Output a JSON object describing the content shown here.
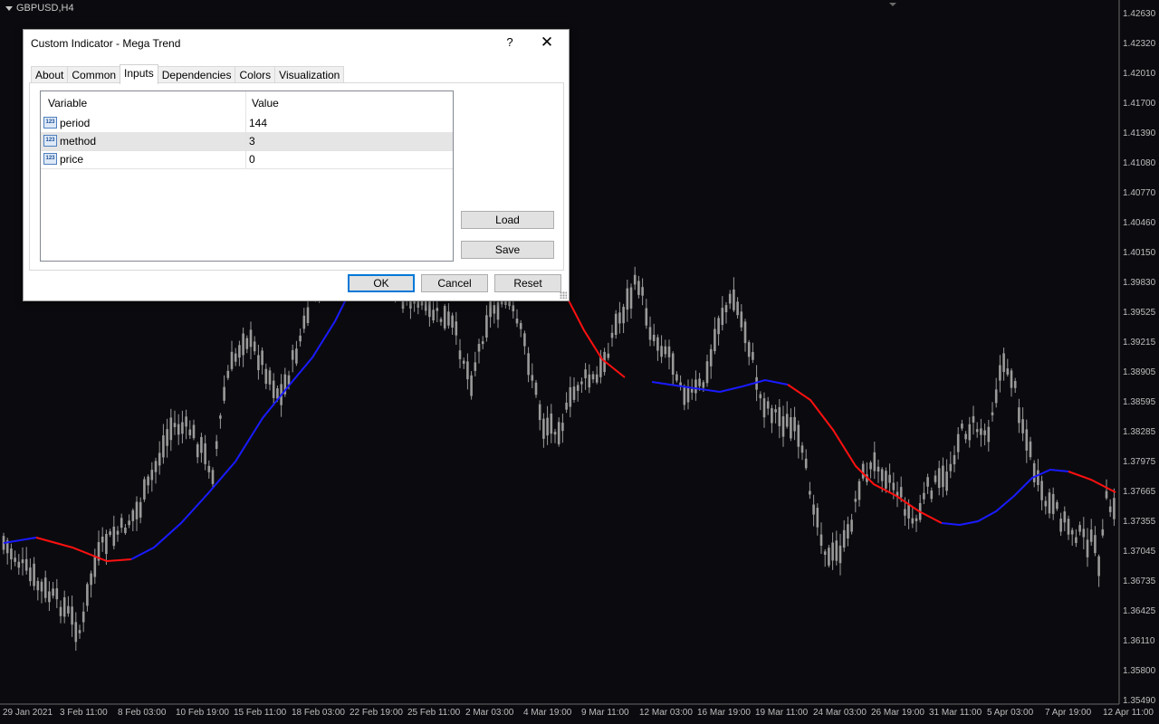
{
  "chart": {
    "symbol": "GBPUSD,H4",
    "price_ticks": [
      "1.42630",
      "1.42320",
      "1.42010",
      "1.41700",
      "1.41390",
      "1.41080",
      "1.40770",
      "1.40460",
      "1.40150",
      "1.39830",
      "1.39525",
      "1.39215",
      "1.38905",
      "1.38595",
      "1.38285",
      "1.37975",
      "1.37665",
      "1.37355",
      "1.37045",
      "1.36735",
      "1.36425",
      "1.36110",
      "1.35800",
      "1.35490"
    ],
    "date_ticks": [
      "29 Jan 2021",
      "3 Feb 11:00",
      "8 Feb 03:00",
      "10 Feb 19:00",
      "15 Feb 11:00",
      "18 Feb 03:00",
      "22 Feb 19:00",
      "25 Feb 11:00",
      "2 Mar 03:00",
      "4 Mar 19:00",
      "9 Mar 11:00",
      "12 Mar 03:00",
      "16 Mar 19:00",
      "19 Mar 11:00",
      "24 Mar 03:00",
      "26 Mar 19:00",
      "31 Mar 11:00",
      "5 Apr 03:00",
      "7 Apr 19:00",
      "12 Apr 11:00"
    ],
    "colors": {
      "background": "#0b0b0f",
      "candles": "#9a9a9a",
      "trend_up": "#1a1aff",
      "trend_down": "#ff1010"
    }
  },
  "dialog": {
    "title": "Custom Indicator - Mega Trend",
    "help_label": "?",
    "close_label": "✕",
    "tabs": [
      {
        "label": "About"
      },
      {
        "label": "Common"
      },
      {
        "label": "Inputs",
        "active": true
      },
      {
        "label": "Dependencies"
      },
      {
        "label": "Colors"
      },
      {
        "label": "Visualization"
      }
    ],
    "grid": {
      "headers": {
        "variable": "Variable",
        "value": "Value"
      },
      "rows": [
        {
          "icon": "123",
          "variable": "period",
          "value": "144"
        },
        {
          "icon": "123",
          "variable": "method",
          "value": "3"
        },
        {
          "icon": "123",
          "variable": "price",
          "value": "0"
        }
      ]
    },
    "buttons": {
      "load": "Load",
      "save": "Save",
      "ok": "OK",
      "cancel": "Cancel",
      "reset": "Reset"
    }
  }
}
